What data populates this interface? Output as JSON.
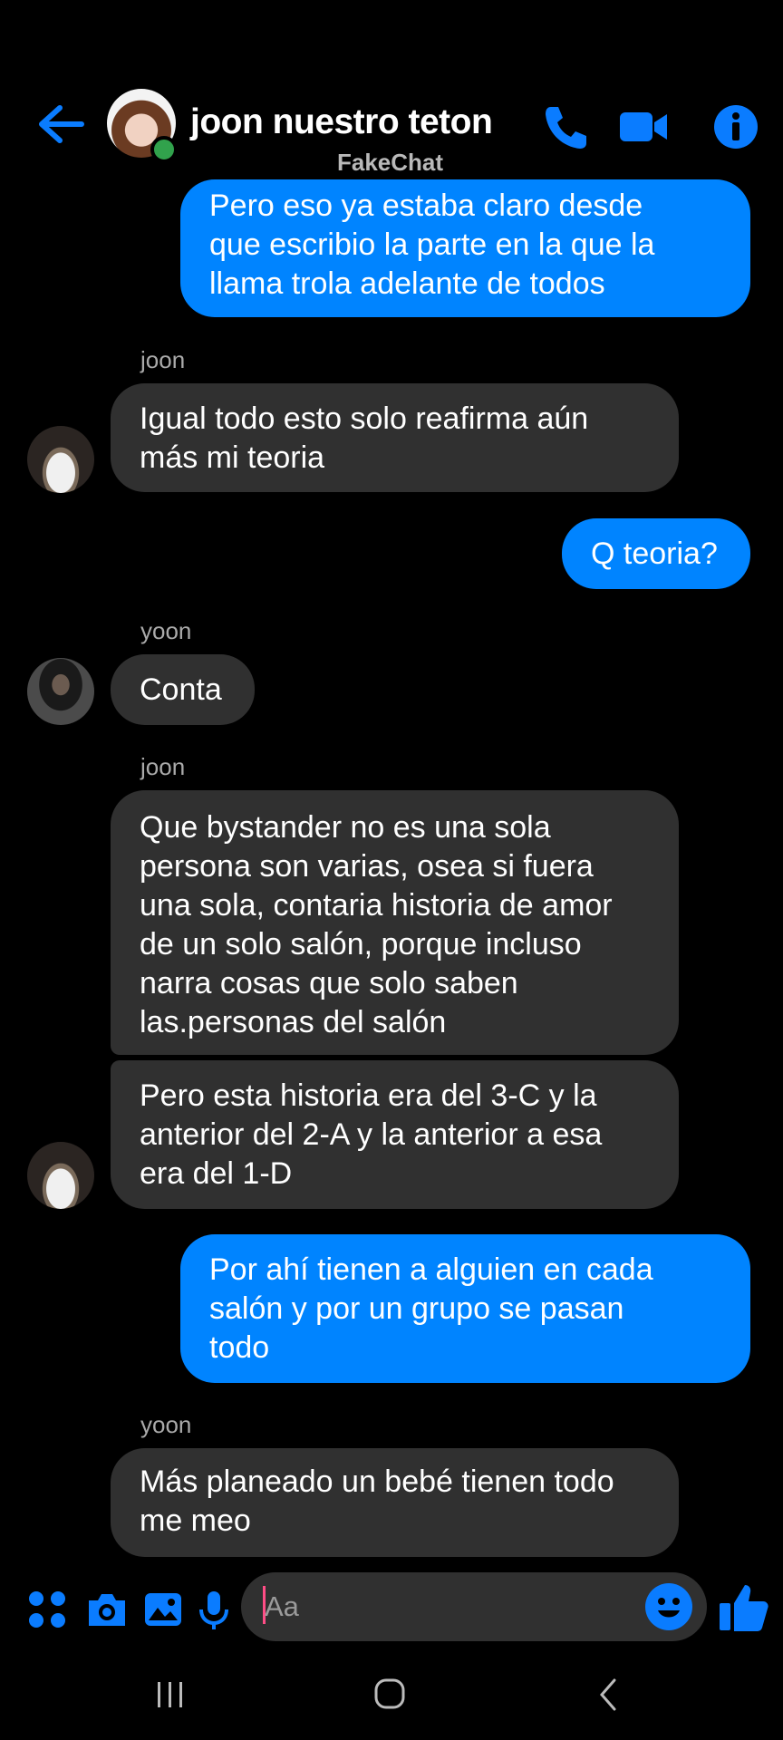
{
  "header": {
    "contact_name": "joon nuestro teton",
    "watermark": "FakeChat",
    "icons": [
      "back-arrow-icon",
      "phone-icon",
      "video-camera-icon",
      "info-icon"
    ]
  },
  "messages": [
    {
      "side": "out",
      "lines": [
        "Pero eso ya estaba claro desde",
        "que escribio la parte en la que la",
        "llama trola adelante de todos"
      ]
    },
    {
      "side": "in",
      "sender": "joon",
      "lines": [
        "Igual todo esto solo reafirma aún",
        "más mi teoria"
      ]
    },
    {
      "side": "out",
      "lines": [
        "Q teoria?"
      ]
    },
    {
      "side": "in",
      "sender": "yoon",
      "lines": [
        "Conta"
      ]
    },
    {
      "side": "in",
      "sender": "joon",
      "lines": [
        "Que bystander no es una sola",
        "persona son varias, osea si fuera",
        "una sola, contaria historia de amor",
        "de un solo salón, porque incluso",
        "narra cosas que solo saben",
        "las.personas del salón"
      ]
    },
    {
      "side": "in",
      "lines": [
        "Pero esta historia era del 3-C y la",
        "anterior del 2-A y la anterior a esa",
        "era del 1-D"
      ]
    },
    {
      "side": "out",
      "lines": [
        "Por ahí tienen a alguien en cada",
        "salón y por un grupo se pasan",
        "todo"
      ]
    },
    {
      "side": "in",
      "sender": "yoon",
      "lines": [
        "Más planeado un bebé tienen todo",
        "me meo"
      ]
    }
  ],
  "composer": {
    "placeholder": "Aa",
    "icons": [
      "apps-icon",
      "camera-icon",
      "gallery-icon",
      "microphone-icon",
      "emoji-icon",
      "thumbs-up-icon"
    ]
  },
  "colors": {
    "accent": "#0084ff",
    "incoming_bubble": "#303030",
    "background": "#000000",
    "online": "#31a24c"
  }
}
